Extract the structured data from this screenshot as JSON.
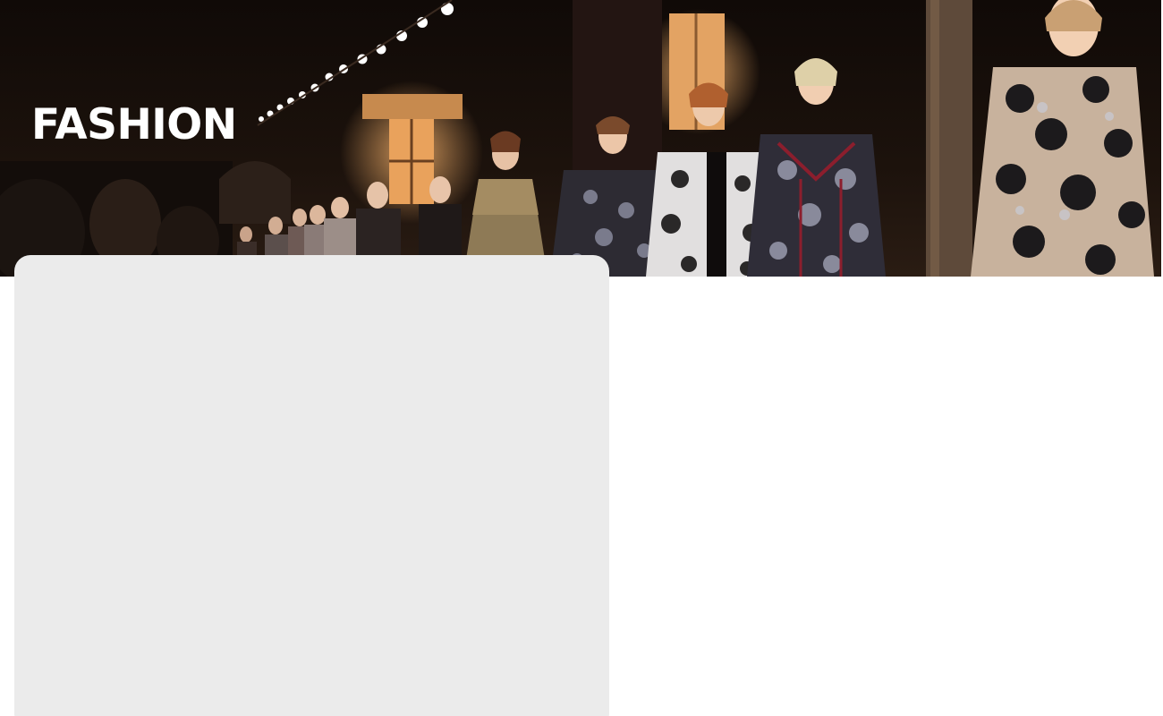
{
  "hero": {
    "title": "FASHION",
    "image_description_icon": "runway-photo-icon"
  },
  "colors": {
    "title_text": "#ffffff",
    "hero_background": "#0b0705",
    "card_background": "#ebebeb",
    "page_background": "#ffffff"
  }
}
